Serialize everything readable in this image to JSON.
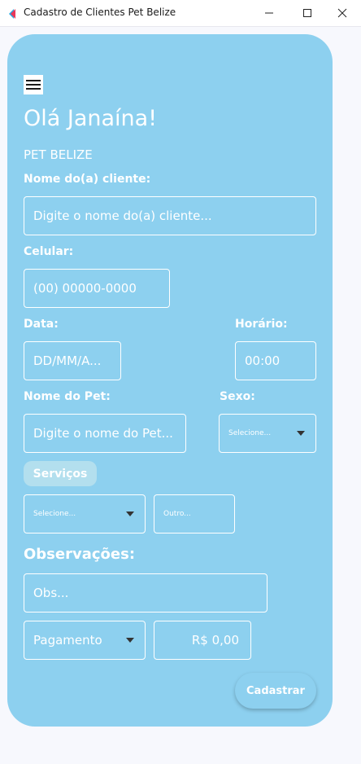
{
  "window": {
    "title": "Cadastro de Clientes Pet Belize"
  },
  "header": {
    "greeting": "Olá Janaína!",
    "brand": "PET BELIZE"
  },
  "form": {
    "client_name": {
      "label": "Nome do(a) cliente:",
      "placeholder": "Digite o nome do(a) cliente..."
    },
    "phone": {
      "label": "Celular:",
      "placeholder": "(00) 00000-0000"
    },
    "date": {
      "label": "Data:",
      "placeholder": "DD/MM/A..."
    },
    "time": {
      "label": "Horário:",
      "placeholder": "00:00"
    },
    "pet_name": {
      "label": "Nome do Pet:",
      "placeholder": "Digite o nome do Pet..."
    },
    "sex": {
      "label": "Sexo:",
      "selected": "Selecione..."
    },
    "services": {
      "label": "Serviços",
      "selected": "Selecione...",
      "other_placeholder": "Outro..."
    },
    "notes": {
      "label": "Observações:",
      "placeholder": "Obs..."
    },
    "payment": {
      "selected": "Pagamento"
    },
    "amount": {
      "value": "R$ 0,00"
    },
    "submit_label": "Cadastrar"
  },
  "colors": {
    "card_background": "#8dd0ef",
    "chip_background": "#b3dfee",
    "page_background": "#f7f8fd"
  }
}
